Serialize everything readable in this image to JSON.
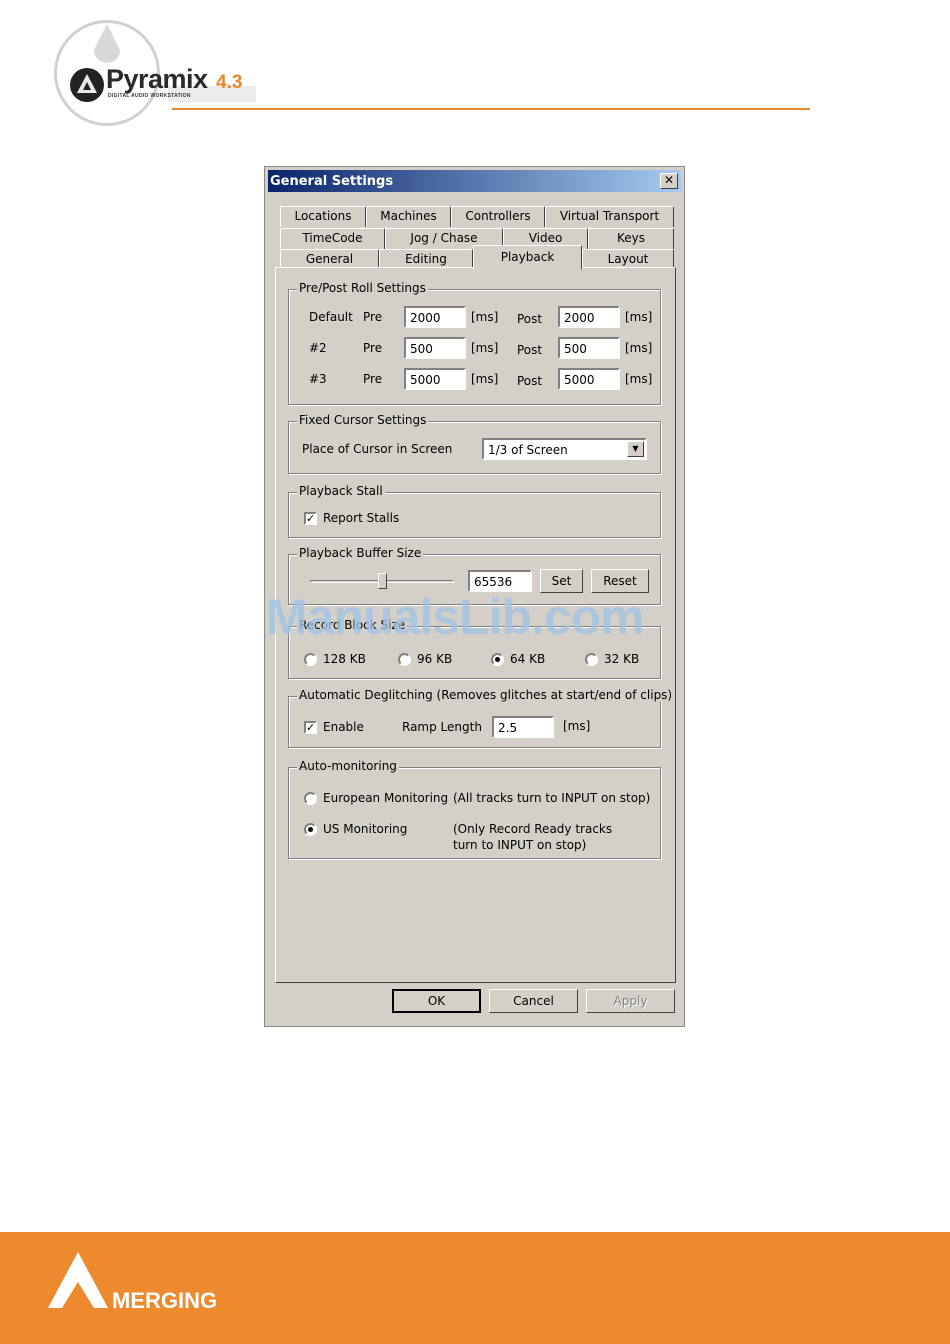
{
  "header": {
    "brand": "Pyramix",
    "version": "4.3",
    "subtitle": "DIGITAL AUDIO WORKSTATION",
    "accent_color": "#e8872c"
  },
  "dialog": {
    "title": "General Settings",
    "close_glyph": "✕",
    "tabs_row1": [
      "Locations",
      "Machines",
      "Controllers",
      "Virtual Transport"
    ],
    "tabs_row2": [
      "TimeCode",
      "Jog / Chase",
      "Video",
      "Keys"
    ],
    "tabs_row3": [
      "General",
      "Editing",
      "Playback",
      "Layout"
    ],
    "active_tab": "Playback",
    "preroll": {
      "title": "Pre/Post Roll Settings",
      "rows": [
        {
          "name": "Default",
          "pre_label": "Pre",
          "pre": "2000",
          "pre_unit": "[ms]",
          "post_label": "Post",
          "post": "2000",
          "post_unit": "[ms]"
        },
        {
          "name": "#2",
          "pre_label": "Pre",
          "pre": "500",
          "pre_unit": "[ms]",
          "post_label": "Post",
          "post": "500",
          "post_unit": "[ms]"
        },
        {
          "name": "#3",
          "pre_label": "Pre",
          "pre": "5000",
          "pre_unit": "[ms]",
          "post_label": "Post",
          "post": "5000",
          "post_unit": "[ms]"
        }
      ]
    },
    "cursor": {
      "title": "Fixed Cursor Settings",
      "label": "Place of Cursor in Screen",
      "value": "1/3 of Screen"
    },
    "stall": {
      "title": "Playback Stall",
      "checkbox_label": "Report Stalls",
      "checked": true
    },
    "buffer": {
      "title": "Playback Buffer Size",
      "value": "65536",
      "slider_fraction": 0.5,
      "set_label": "Set",
      "reset_label": "Reset"
    },
    "block": {
      "title": "Record Block Size",
      "options": [
        "128 KB",
        "96 KB",
        "64 KB",
        "32 KB"
      ],
      "selected": "64 KB"
    },
    "deglitch": {
      "title": "Automatic Deglitching (Removes glitches at start/end of clips)",
      "enable_label": "Enable",
      "enabled": true,
      "ramp_label": "Ramp Length",
      "ramp_value": "2.5",
      "ramp_unit": "[ms]"
    },
    "monitoring": {
      "title": "Auto-monitoring",
      "european_label": "European Monitoring",
      "european_desc": "(All tracks turn to INPUT on stop)",
      "us_label": "US Monitoring",
      "us_desc_line1": "(Only Record Ready tracks",
      "us_desc_line2": "turn to INPUT on stop)",
      "selected": "US Monitoring"
    },
    "buttons": {
      "ok": "OK",
      "cancel": "Cancel",
      "apply": "Apply"
    }
  },
  "watermark": "ManualsLib.com",
  "footer": {
    "brand": "MERGING",
    "color": "#ee8a2e"
  }
}
